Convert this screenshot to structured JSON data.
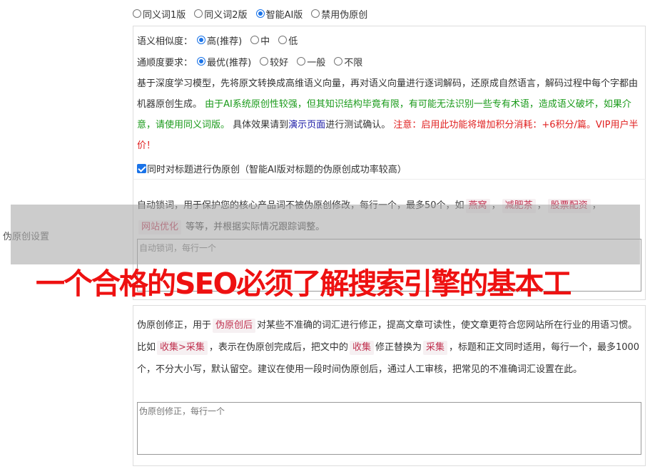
{
  "left_label": "伪原创设置",
  "mode_options": [
    {
      "label": "同义词1版",
      "checked": false
    },
    {
      "label": "同义词2版",
      "checked": false
    },
    {
      "label": "智能AI版",
      "checked": true
    },
    {
      "label": "禁用伪原创",
      "checked": false
    }
  ],
  "similarity": {
    "label": "语义相似度：",
    "options": [
      {
        "label": "高(推荐)",
        "checked": true
      },
      {
        "label": "中",
        "checked": false
      },
      {
        "label": "低",
        "checked": false
      }
    ]
  },
  "fluency": {
    "label": "通顺度要求：",
    "options": [
      {
        "label": "最优(推荐)",
        "checked": true
      },
      {
        "label": "较好",
        "checked": false
      },
      {
        "label": "一般",
        "checked": false
      },
      {
        "label": "不限",
        "checked": false
      }
    ]
  },
  "description": {
    "part1": "基于深度学习模型，先将原文转换成高维语义向量，再对语义向量进行逐词解码，还原成自然语言，解码过程中每个字都由机器原创生成。",
    "green": "由于AI系统原创性较强，但其知识结构毕竟有限，有可能无法识别一些专有术语，造成语义破坏，如果介意，请使用同义词版。",
    "part2": "具体效果请到",
    "link": "演示页面",
    "part3": "进行测试确认。",
    "red": "注意：启用此功能将增加积分消耗：+6积分/篇。VIP用户半价！"
  },
  "title_checkbox": {
    "label": "同时对标题进行伪原创（智能AI版对标题的伪原创成功率较高）",
    "checked": true
  },
  "lock_words": {
    "text1": "自动锁词，用于保护您的核心产品词不被伪原创修改，每行一个，最多50个，如",
    "examples": [
      "燕窝",
      "减肥茶",
      "股票配资",
      "网站优化"
    ],
    "text2": "等等，并根据实际情况跟踪调整。",
    "placeholder": "自动锁词，每行一个"
  },
  "correction": {
    "text1": "伪原创修正，用于",
    "tag1": "伪原创后",
    "text2": "对某些不准确的词汇进行修正，提高文章可读性，使文章更符合您网站所在行业的用语习惯。比如",
    "tag2": "收集>采集",
    "text3": "，表示在伪原创完成后，把文中的",
    "tag3": "收集",
    "text4": "修正替换为",
    "tag4": "采集",
    "text5": "，标题和正文同时适用，每行一个，最多1000个，不分大小写，默认留空。建议在使用一段时间伪原创后，通过人工审核，把常见的不准确词汇设置在此。",
    "placeholder": "伪原创修正，每行一个"
  },
  "caption": "一个合格的SEO必须了解搜索引擎的基本工"
}
